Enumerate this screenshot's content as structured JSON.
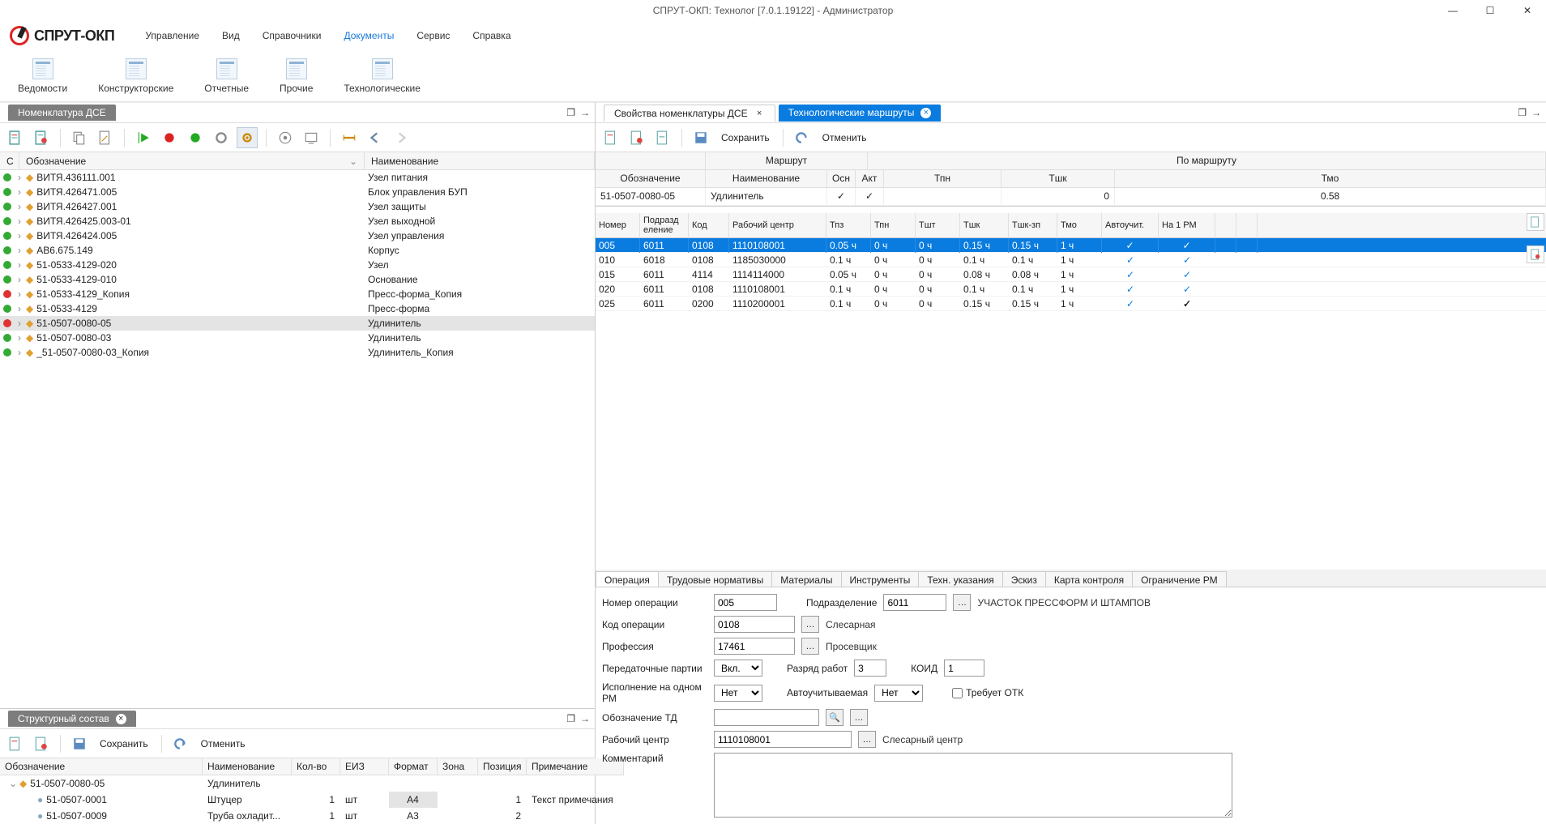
{
  "window_title": "СПРУТ-ОКП: Технолог [7.0.1.19122] - Администратор",
  "app_name": "СПРУТ-ОКП",
  "menu": [
    "Управление",
    "Вид",
    "Справочники",
    "Документы",
    "Сервис",
    "Справка"
  ],
  "menu_active": 3,
  "ribbon": [
    {
      "label": "Ведомости"
    },
    {
      "label": "Конструкторские"
    },
    {
      "label": "Отчетные"
    },
    {
      "label": "Прочие"
    },
    {
      "label": "Технологические"
    }
  ],
  "left_tab": "Номенклатура ДСЕ",
  "right_tabs": [
    {
      "label": "Свойства номенклатуры ДСЕ",
      "active": false,
      "closable": true
    },
    {
      "label": "Технологические маршруты",
      "active": true,
      "closable": true
    }
  ],
  "toolbar_right": {
    "save": "Сохранить",
    "cancel": "Отменить"
  },
  "tree_headers": {
    "c": "С",
    "oboz": "Обозначение",
    "naim": "Наименование"
  },
  "tree_rows": [
    {
      "status": "g",
      "oboz": "ВИТЯ.436111.001",
      "naim": "Узел питания"
    },
    {
      "status": "g",
      "oboz": "ВИТЯ.426471.005",
      "naim": "Блок управления БУП"
    },
    {
      "status": "g",
      "oboz": "ВИТЯ.426427.001",
      "naim": "Узел защиты"
    },
    {
      "status": "g",
      "oboz": "ВИТЯ.426425.003-01",
      "naim": "Узел выходной"
    },
    {
      "status": "g",
      "oboz": "ВИТЯ.426424.005",
      "naim": "Узел управления"
    },
    {
      "status": "g",
      "oboz": "АВ6.675.149",
      "naim": "Корпус"
    },
    {
      "status": "g",
      "oboz": "51-0533-4129-020",
      "naim": "Узел"
    },
    {
      "status": "g",
      "oboz": "51-0533-4129-010",
      "naim": "Основание"
    },
    {
      "status": "r",
      "oboz": "51-0533-4129_Копия",
      "naim": "Пресс-форма_Копия"
    },
    {
      "status": "g",
      "oboz": "51-0533-4129",
      "naim": "Пресс-форма"
    },
    {
      "status": "r",
      "oboz": "51-0507-0080-05",
      "naim": "Удлинитель",
      "sel": true
    },
    {
      "status": "g",
      "oboz": "51-0507-0080-03",
      "naim": "Удлинитель"
    },
    {
      "status": "g",
      "oboz": "_51-0507-0080-03_Копия",
      "naim": "Удлинитель_Копия"
    }
  ],
  "mid_tab": "Структурный состав",
  "mid_toolbar": {
    "save": "Сохранить",
    "cancel": "Отменить"
  },
  "struct_headers": {
    "oboz": "Обозначение",
    "naim": "Наименование",
    "kolvo": "Кол-во",
    "eiz": "ЕИЗ",
    "format": "Формат",
    "zona": "Зона",
    "pos": "Позиция",
    "prim": "Примечание"
  },
  "struct_rows": [
    {
      "lvl": 0,
      "oboz": "51-0507-0080-05",
      "naim": "Удлинитель",
      "kolvo": "",
      "eiz": "",
      "format": "",
      "zona": "",
      "pos": "",
      "prim": ""
    },
    {
      "lvl": 1,
      "oboz": "51-0507-0001",
      "naim": "Штуцер",
      "kolvo": "1",
      "eiz": "шт",
      "format": "A4",
      "zona": "",
      "pos": "1",
      "prim": "Текст примечания",
      "hl": true
    },
    {
      "lvl": 1,
      "oboz": "51-0507-0009",
      "naim": "Труба охладит...",
      "kolvo": "1",
      "eiz": "шт",
      "format": "A3",
      "zona": "",
      "pos": "2",
      "prim": ""
    }
  ],
  "route_group": {
    "left": "Маршрут",
    "right": "По маршруту"
  },
  "route_head": {
    "oboz": "Обозначение",
    "naim": "Наименование",
    "osn": "Осн",
    "akt": "Акт",
    "tpn": "Тпн",
    "tshk": "Тшк",
    "tmo": "Тмо"
  },
  "route_row": {
    "oboz": "51-0507-0080-05",
    "naim": "Удлинитель",
    "osn": "✓",
    "akt": "✓",
    "tpn": "",
    "tshk": "0",
    "tmo": "0.58"
  },
  "ops_head": {
    "nomer": "Номер",
    "podr": "Подразд\nеление",
    "kod": "Код",
    "rc": "Рабочий центр",
    "tpz": "Тпз",
    "tpn": "Тпн",
    "tsht": "Тшт",
    "tshk": "Тшк",
    "tshkzp": "Тшк-зп",
    "tmo": "Тмо",
    "auto": "Автоучит.",
    "na1pm": "На 1 РМ"
  },
  "ops_rows": [
    {
      "n": "005",
      "p": "6011",
      "k": "0108",
      "rc": "1110108001",
      "tpz": "0.05 ч",
      "tpn": "0 ч",
      "tsht": "0 ч",
      "tshk": "0.15 ч",
      "tshkzp": "0.15 ч",
      "tmo": "1 ч",
      "auto": true,
      "pm": true,
      "sel": true
    },
    {
      "n": "010",
      "p": "6018",
      "k": "0108",
      "rc": "1185030000",
      "tpz": "0.1 ч",
      "tpn": "0 ч",
      "tsht": "0 ч",
      "tshk": "0.1 ч",
      "tshkzp": "0.1 ч",
      "tmo": "1 ч",
      "auto": true,
      "pm": true
    },
    {
      "n": "015",
      "p": "6011",
      "k": "4114",
      "rc": "1114114000",
      "tpz": "0.05 ч",
      "tpn": "0 ч",
      "tsht": "0 ч",
      "tshk": "0.08 ч",
      "tshkzp": "0.08 ч",
      "tmo": "1 ч",
      "auto": true,
      "pm": true
    },
    {
      "n": "020",
      "p": "6011",
      "k": "0108",
      "rc": "1110108001",
      "tpz": "0.1 ч",
      "tpn": "0 ч",
      "tsht": "0 ч",
      "tshk": "0.1 ч",
      "tshkzp": "0.1 ч",
      "tmo": "1 ч",
      "auto": true,
      "pm": true
    },
    {
      "n": "025",
      "p": "6011",
      "k": "0200",
      "rc": "1110200001",
      "tpz": "0.1 ч",
      "tpn": "0 ч",
      "tsht": "0 ч",
      "tshk": "0.15 ч",
      "tshkzp": "0.15 ч",
      "tmo": "1 ч",
      "auto": true,
      "pm": true,
      "pmbold": true
    }
  ],
  "detail_tabs": [
    "Операция",
    "Трудовые нормативы",
    "Материалы",
    "Инструменты",
    "Техн. указания",
    "Эскиз",
    "Карта контроля",
    "Ограничение РМ"
  ],
  "form": {
    "oper_num_label": "Номер операции",
    "oper_num": "005",
    "podr_label": "Подразделение",
    "podr": "6011",
    "podr_name": "УЧАСТОК ПРЕССФОРМ И ШТАМПОВ",
    "kod_label": "Код операции",
    "kod": "0108",
    "kod_name": "Слесарная",
    "prof_label": "Профессия",
    "prof": "17461",
    "prof_name": "Просевщик",
    "pered_label": "Передаточные партии",
    "pered": "Вкл.",
    "razr_label": "Разряд работ",
    "razr": "3",
    "koid_label": "КОИД",
    "koid": "1",
    "isp_label": "Исполнение на одном РМ",
    "isp": "Нет",
    "auto_label": "Автоучитываемая",
    "auto": "Нет",
    "otk_label": "Требует ОТК",
    "td_label": "Обозначение ТД",
    "td": "",
    "rc_label": "Рабочий центр",
    "rc": "1110108001",
    "rc_name": "Слесарный центр",
    "comm_label": "Комментарий",
    "comm": ""
  }
}
